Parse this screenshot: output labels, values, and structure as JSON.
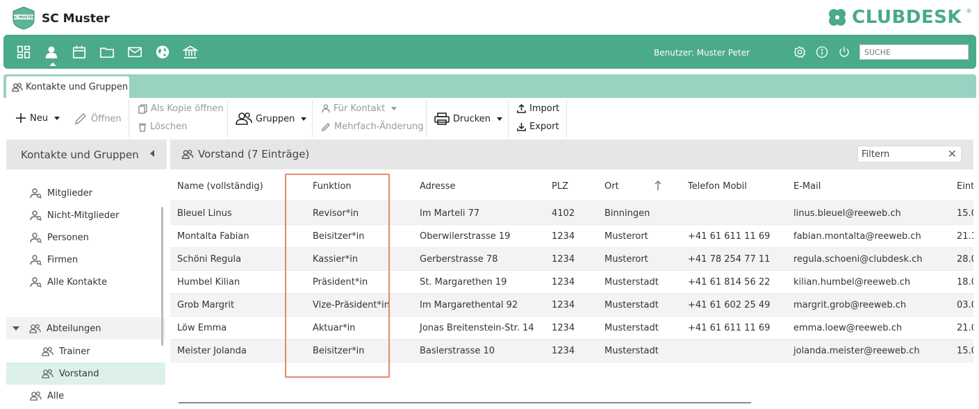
{
  "header": {
    "logo_text": "SC MUSTER",
    "app_title": "SC Muster",
    "brand": "CLUBDESK",
    "brand_mark": "®"
  },
  "navbar": {
    "icons": [
      "dashboard-icon",
      "contacts-icon",
      "calendar-icon",
      "folder-icon",
      "mail-icon",
      "globe-icon",
      "bank-icon"
    ],
    "user_label": "Benutzer: Muster Peter",
    "search_placeholder": "SUCHE"
  },
  "tab": {
    "label": "Kontakte und Gruppen"
  },
  "toolbar": {
    "new": "Neu",
    "open": "Öffnen",
    "open_copy": "Als Kopie öffnen",
    "delete": "Löschen",
    "groups": "Gruppen",
    "for_contact": "Für Kontakt",
    "bulk_edit": "Mehrfach-Änderung",
    "print": "Drucken",
    "import": "Import",
    "export": "Export"
  },
  "sidebar": {
    "title": "Kontakte und Gruppen",
    "items": [
      {
        "label": "Mitglieder"
      },
      {
        "label": "Nicht-Mitglieder"
      },
      {
        "label": "Personen"
      },
      {
        "label": "Firmen"
      },
      {
        "label": "Alle Kontakte"
      }
    ],
    "group": {
      "label": "Abteilungen",
      "children": [
        {
          "label": "Trainer"
        },
        {
          "label": "Vorstand"
        }
      ]
    },
    "last": {
      "label": "Alle"
    }
  },
  "panel": {
    "title": "Vorstand (7 Einträge)",
    "filter_placeholder": "Filtern",
    "columns": [
      "Name (vollständig)",
      "Funktion",
      "Adresse",
      "PLZ",
      "Ort",
      "Telefon Mobil",
      "E-Mail",
      "Eint"
    ],
    "rows": [
      [
        "Bleuel Linus",
        "Revisor*in",
        "Im Marteli 77",
        "4102",
        "Binningen",
        "",
        "linus.bleuel@reeweb.ch",
        "15.0"
      ],
      [
        "Montalta Fabian",
        "Beisitzer*in",
        "Oberwilerstrasse 19",
        "1234",
        "Musterort",
        "+41 61 611 11 69",
        "fabian.montalta@reeweb.ch",
        "21.1"
      ],
      [
        "Schöni Regula",
        "Kassier*in",
        "Gerberstrasse 78",
        "1234",
        "Musterort",
        "+41 78 254 77 11",
        "regula.schoeni@clubdesk.ch",
        "28.0"
      ],
      [
        "Humbel Kilian",
        "Präsident*in",
        "St. Margarethen 19",
        "1234",
        "Musterstadt",
        "+41 61 814 56 22",
        "kilian.humbel@reeweb.ch",
        "18.0"
      ],
      [
        "Grob Margrit",
        "Vize-Präsident*in",
        "Im Margarethental 92",
        "1234",
        "Musterstadt",
        "+41 61 602 25 49",
        "margrit.grob@reeweb.ch",
        "03.0"
      ],
      [
        "Löw Emma",
        "Aktuar*in",
        "Jonas Breitenstein-Str. 14",
        "1234",
        "Musterstadt",
        "+41 61 611 11 69",
        "emma.loew@reeweb.ch",
        "21.0"
      ],
      [
        "Meister Jolanda",
        "Beisitzer*in",
        "Baslerstrasse 10",
        "1234",
        "Musterstadt",
        "",
        "jolanda.meister@reeweb.ch",
        "15.0"
      ]
    ]
  },
  "colors": {
    "accent": "#4aaa8a",
    "tab_strip": "#9ad2c2",
    "highlight": "#e08a66"
  }
}
